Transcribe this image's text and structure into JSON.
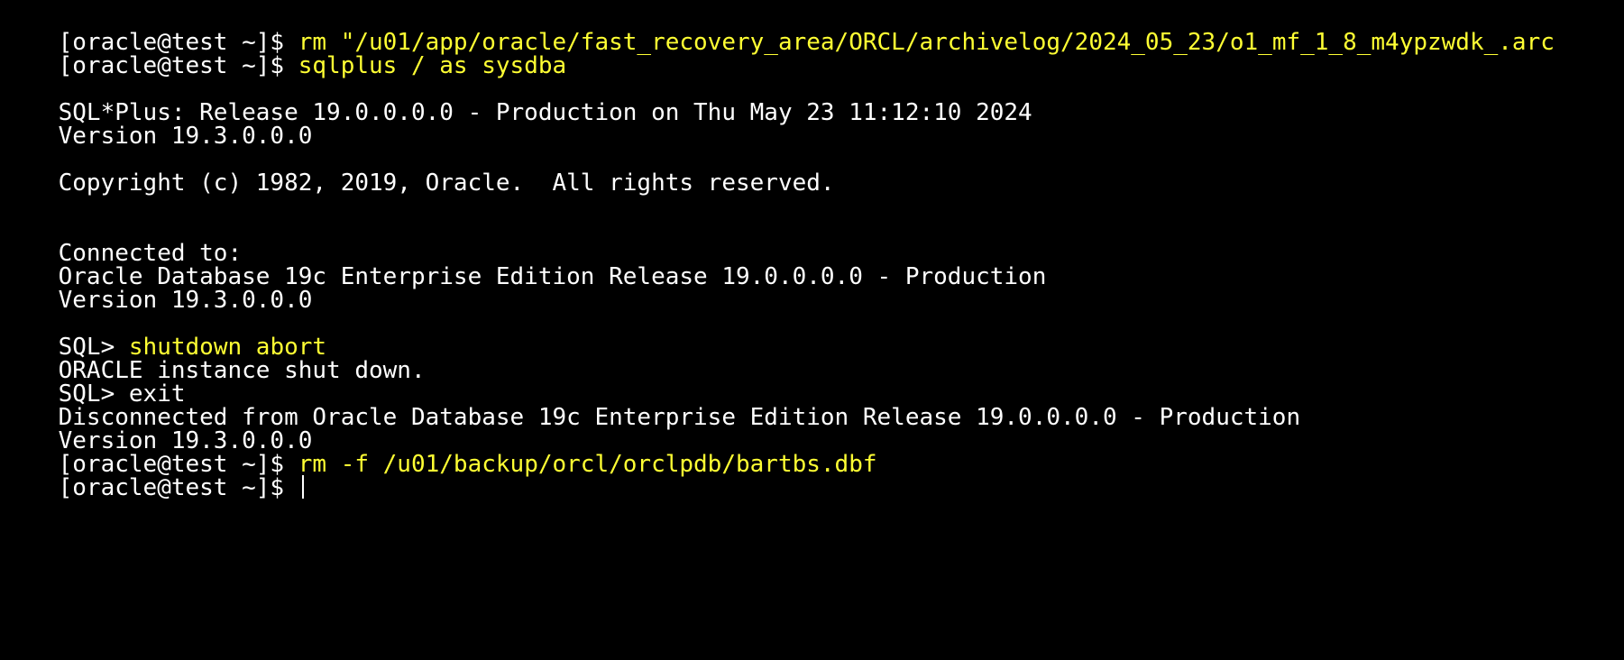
{
  "colors": {
    "background": "#000000",
    "output_text": "#ffffff",
    "command_text": "#ffff33"
  },
  "lines": [
    {
      "prompt": "[oracle@test ~]$ ",
      "command": "rm \"/u01/app/oracle/fast_recovery_area/ORCL/archivelog/2024_05_23/o1_mf_1_8_m4ypzwdk_.arc"
    },
    {
      "prompt": "[oracle@test ~]$ ",
      "command": "sqlplus / as sysdba"
    },
    {
      "output": "SQL*Plus: Release 19.0.0.0.0 - Production on Thu May 23 11:12:10 2024"
    },
    {
      "output": "Version 19.3.0.0.0"
    },
    {
      "output": "Copyright (c) 1982, 2019, Oracle.  All rights reserved."
    },
    {
      "output": "Connected to:"
    },
    {
      "output": "Oracle Database 19c Enterprise Edition Release 19.0.0.0.0 - Production"
    },
    {
      "output": "Version 19.3.0.0.0"
    },
    {
      "prompt": "SQL> ",
      "command": "shutdown abort"
    },
    {
      "output": "ORACLE instance shut down."
    },
    {
      "prompt": "SQL> ",
      "output": "exit"
    },
    {
      "output": "Disconnected from Oracle Database 19c Enterprise Edition Release 19.0.0.0.0 - Production"
    },
    {
      "output": "Version 19.3.0.0.0"
    },
    {
      "prompt": "[oracle@test ~]$ ",
      "command": "rm -f /u01/backup/orcl/orclpdb/bartbs.dbf"
    },
    {
      "prompt": "[oracle@test ~]$ ",
      "command": ""
    }
  ]
}
